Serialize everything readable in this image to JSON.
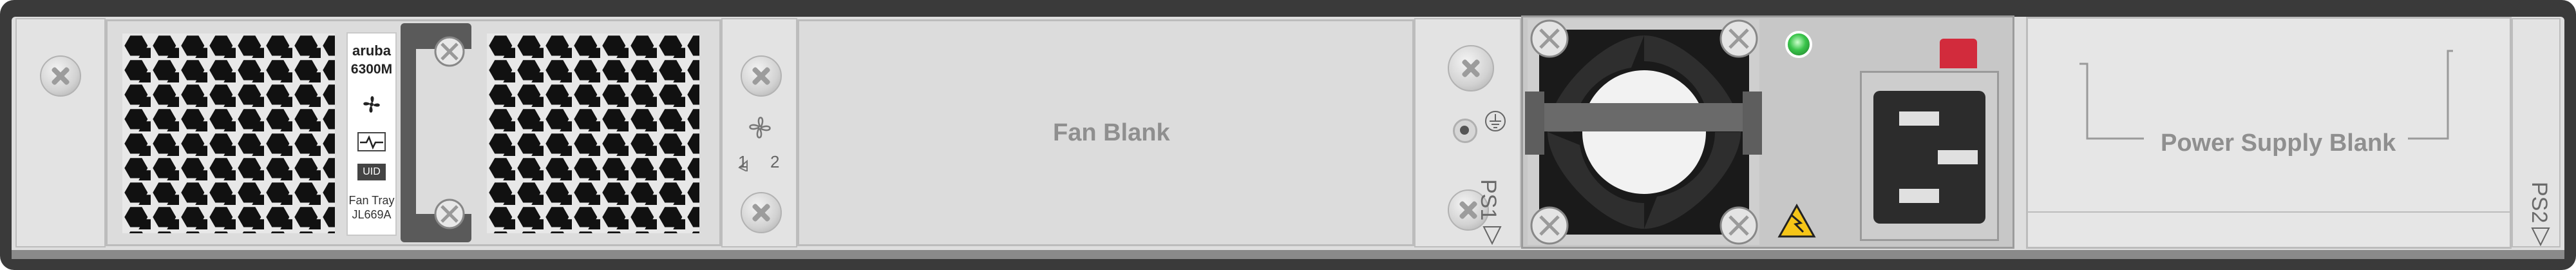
{
  "fan_tray": {
    "brand": "aruba",
    "model": "6300M",
    "uid_label": "UID",
    "tray_name": "Fan Tray",
    "part_number": "JL669A",
    "bay_labels": [
      "1",
      "2"
    ]
  },
  "fan_blank": {
    "label": "Fan Blank"
  },
  "power_supply_1": {
    "slot_label": "PS1"
  },
  "power_supply_blank": {
    "label": "Power Supply Blank",
    "slot_label": "PS2"
  },
  "colors": {
    "chassis": "#3a3a3a",
    "panel": "#dedede",
    "status_led": "#39c44a",
    "release_tab": "#d22b3c",
    "warning": "#f5c518"
  },
  "icons": [
    "fan-icon",
    "heartbeat-icon",
    "ground-icon",
    "warning-icon",
    "power-inlet-icon"
  ]
}
